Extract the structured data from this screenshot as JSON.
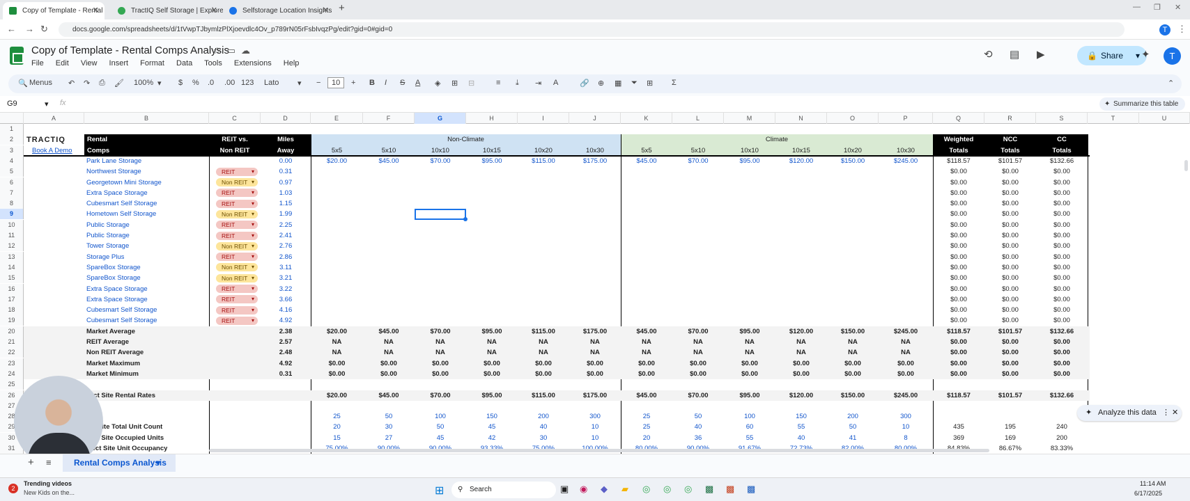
{
  "browser": {
    "tabs": [
      {
        "title": "Copy of Template - Rental Com",
        "color": "#1e8e3e"
      },
      {
        "title": "TractIQ Self Storage | Explore n",
        "color": "#34a853"
      },
      {
        "title": "Selfstorage Location Insights",
        "color": "#1a73e8"
      }
    ],
    "url": "docs.google.com/spreadsheets/d/1tVwpTJbymlzPlXjoevdlc4Ov_p789rN05rFsbIvqzPg/edit?gid=0#gid=0"
  },
  "doc": {
    "title": "Copy of Template - Rental Comps Analysis",
    "menus": [
      "File",
      "Edit",
      "View",
      "Insert",
      "Format",
      "Data",
      "Tools",
      "Extensions",
      "Help"
    ],
    "share_label": "Share",
    "avatar_letter": "T"
  },
  "toolbar": {
    "menus_label": "Menus",
    "zoom": "100%",
    "currency": "$",
    "percent": "%",
    "dec_less": ".0",
    "dec_more": ".00",
    "number_fmt": "123",
    "font": "Lato",
    "font_size": "10",
    "bold": "B",
    "italic": "I",
    "strike": "S",
    "text_color": "A"
  },
  "formula_bar": {
    "cell_ref": "G9",
    "fx": "fx",
    "summarize_label": "Summarize this table"
  },
  "columns": [
    "A",
    "B",
    "C",
    "D",
    "E",
    "F",
    "G",
    "H",
    "I",
    "J",
    "K",
    "L",
    "M",
    "N",
    "O",
    "P",
    "Q",
    "R",
    "S",
    "T",
    "U"
  ],
  "header": {
    "brand": "TRACTIQ",
    "book_demo": "Book A Demo",
    "rental_comps": [
      "Rental",
      "Comps"
    ],
    "reit_vs": [
      "REIT vs.",
      "Non REIT"
    ],
    "miles_away": [
      "Miles",
      "Away"
    ],
    "non_climate": "Non-Climate",
    "climate": "Climate",
    "sizes": [
      "5x5",
      "5x10",
      "10x10",
      "10x15",
      "10x20",
      "10x30"
    ],
    "weighted": [
      "Weighted",
      "Totals"
    ],
    "ncc": [
      "NCC",
      "Totals"
    ],
    "cc": [
      "CC",
      "Totals"
    ]
  },
  "comps": [
    {
      "name": "Park Lane Storage",
      "type": "",
      "miles": "0.00",
      "nc": [
        "$20.00",
        "$45.00",
        "$70.00",
        "$95.00",
        "$115.00",
        "$175.00"
      ],
      "c": [
        "$45.00",
        "$70.00",
        "$95.00",
        "$120.00",
        "$150.00",
        "$245.00"
      ],
      "totals": [
        "$118.57",
        "$101.57",
        "$132.66"
      ]
    },
    {
      "name": "Northwest Storage",
      "type": "REIT",
      "miles": "0.31",
      "totals": [
        "$0.00",
        "$0.00",
        "$0.00"
      ]
    },
    {
      "name": "Georgetown Mini Storage",
      "type": "Non REIT",
      "miles": "0.97",
      "totals": [
        "$0.00",
        "$0.00",
        "$0.00"
      ]
    },
    {
      "name": "Extra Space Storage",
      "type": "REIT",
      "miles": "1.03",
      "totals": [
        "$0.00",
        "$0.00",
        "$0.00"
      ]
    },
    {
      "name": "Cubesmart Self Storage",
      "type": "REIT",
      "miles": "1.15",
      "totals": [
        "$0.00",
        "$0.00",
        "$0.00"
      ]
    },
    {
      "name": "Hometown Self Storage",
      "type": "Non REIT",
      "miles": "1.99",
      "totals": [
        "$0.00",
        "$0.00",
        "$0.00"
      ]
    },
    {
      "name": "Public Storage",
      "type": "REIT",
      "miles": "2.25",
      "totals": [
        "$0.00",
        "$0.00",
        "$0.00"
      ]
    },
    {
      "name": "Public Storage",
      "type": "REIT",
      "miles": "2.41",
      "totals": [
        "$0.00",
        "$0.00",
        "$0.00"
      ]
    },
    {
      "name": "Tower Storage",
      "type": "Non REIT",
      "miles": "2.76",
      "totals": [
        "$0.00",
        "$0.00",
        "$0.00"
      ]
    },
    {
      "name": "Storage Plus",
      "type": "REIT",
      "miles": "2.86",
      "totals": [
        "$0.00",
        "$0.00",
        "$0.00"
      ]
    },
    {
      "name": "SpareBox Storage",
      "type": "Non REIT",
      "miles": "3.11",
      "totals": [
        "$0.00",
        "$0.00",
        "$0.00"
      ]
    },
    {
      "name": "SpareBox Storage",
      "type": "Non REIT",
      "miles": "3.21",
      "totals": [
        "$0.00",
        "$0.00",
        "$0.00"
      ]
    },
    {
      "name": "Extra Space Storage",
      "type": "REIT",
      "miles": "3.22",
      "totals": [
        "$0.00",
        "$0.00",
        "$0.00"
      ]
    },
    {
      "name": "Extra Space Storage",
      "type": "REIT",
      "miles": "3.66",
      "totals": [
        "$0.00",
        "$0.00",
        "$0.00"
      ]
    },
    {
      "name": "Cubesmart Self Storage",
      "type": "REIT",
      "miles": "4.16",
      "totals": [
        "$0.00",
        "$0.00",
        "$0.00"
      ]
    },
    {
      "name": "Cubesmart Self Storage",
      "type": "REIT",
      "miles": "4.92",
      "totals": [
        "$0.00",
        "$0.00",
        "$0.00"
      ]
    }
  ],
  "summary": [
    {
      "label": "Market Average",
      "miles": "2.38",
      "nc": [
        "$20.00",
        "$45.00",
        "$70.00",
        "$95.00",
        "$115.00",
        "$175.00"
      ],
      "c": [
        "$45.00",
        "$70.00",
        "$95.00",
        "$120.00",
        "$150.00",
        "$245.00"
      ],
      "totals": [
        "$118.57",
        "$101.57",
        "$132.66"
      ]
    },
    {
      "label": "REIT Average",
      "miles": "2.57",
      "nc": [
        "NA",
        "NA",
        "NA",
        "NA",
        "NA",
        "NA"
      ],
      "c": [
        "NA",
        "NA",
        "NA",
        "NA",
        "NA",
        "NA"
      ],
      "totals": [
        "$0.00",
        "$0.00",
        "$0.00"
      ]
    },
    {
      "label": "Non REIT Average",
      "miles": "2.48",
      "nc": [
        "NA",
        "NA",
        "NA",
        "NA",
        "NA",
        "NA"
      ],
      "c": [
        "NA",
        "NA",
        "NA",
        "NA",
        "NA",
        "NA"
      ],
      "totals": [
        "$0.00",
        "$0.00",
        "$0.00"
      ]
    },
    {
      "label": "Market Maximum",
      "miles": "4.92",
      "nc": [
        "$0.00",
        "$0.00",
        "$0.00",
        "$0.00",
        "$0.00",
        "$0.00"
      ],
      "c": [
        "$0.00",
        "$0.00",
        "$0.00",
        "$0.00",
        "$0.00",
        "$0.00"
      ],
      "totals": [
        "$0.00",
        "$0.00",
        "$0.00"
      ]
    },
    {
      "label": "Market Minimum",
      "miles": "0.31",
      "nc": [
        "$0.00",
        "$0.00",
        "$0.00",
        "$0.00",
        "$0.00",
        "$0.00"
      ],
      "c": [
        "$0.00",
        "$0.00",
        "$0.00",
        "$0.00",
        "$0.00",
        "$0.00"
      ],
      "totals": [
        "$0.00",
        "$0.00",
        "$0.00"
      ]
    }
  ],
  "subject": {
    "rates_label": "ect Site Rental Rates",
    "rates_nc": [
      "$20.00",
      "$45.00",
      "$70.00",
      "$95.00",
      "$115.00",
      "$175.00"
    ],
    "rates_c": [
      "$45.00",
      "$70.00",
      "$95.00",
      "$120.00",
      "$150.00",
      "$245.00"
    ],
    "rates_totals": [
      "$118.57",
      "$101.57",
      "$132.66"
    ],
    "sqft_label": "qft",
    "sqft_nc": [
      "25",
      "50",
      "100",
      "150",
      "200",
      "300"
    ],
    "sqft_c": [
      "25",
      "50",
      "100",
      "150",
      "200",
      "300"
    ],
    "count_label": "ct Site Total Unit Count",
    "count_nc": [
      "20",
      "30",
      "50",
      "45",
      "40",
      "10"
    ],
    "count_c": [
      "25",
      "40",
      "60",
      "55",
      "50",
      "10"
    ],
    "count_totals": [
      "435",
      "195",
      "240"
    ],
    "occ_label": "ect Site Occupied Units",
    "occ_nc": [
      "15",
      "27",
      "45",
      "42",
      "30",
      "10"
    ],
    "occ_c": [
      "20",
      "36",
      "55",
      "40",
      "41",
      "8"
    ],
    "occ_totals": [
      "369",
      "169",
      "200"
    ],
    "occp_label": "ject Site Unit Occupancy",
    "occp_nc": [
      "75.00%",
      "90.00%",
      "90.00%",
      "93.33%",
      "75.00%",
      "100.00%"
    ],
    "occp_c": [
      "80.00%",
      "90.00%",
      "91.67%",
      "72.73%",
      "82.00%",
      "80.00%"
    ],
    "occp_totals": [
      "84.83%",
      "86.67%",
      "83.33%"
    ]
  },
  "analyze_label": "Analyze this data",
  "sheet_tab": "Rental Comps Analysis",
  "taskbar": {
    "trending_title": "Trending videos",
    "trending_sub": "New Kids on the...",
    "badge": "2",
    "search_label": "Search",
    "time": "11:14 AM",
    "date": "6/17/2025"
  },
  "colors": {
    "nc_band": "#cfe2f3",
    "c_band": "#d9ead3",
    "link_blue": "#1155cc",
    "reit_pill": "#f4c7c3",
    "non_reit_pill": "#fde59b"
  }
}
